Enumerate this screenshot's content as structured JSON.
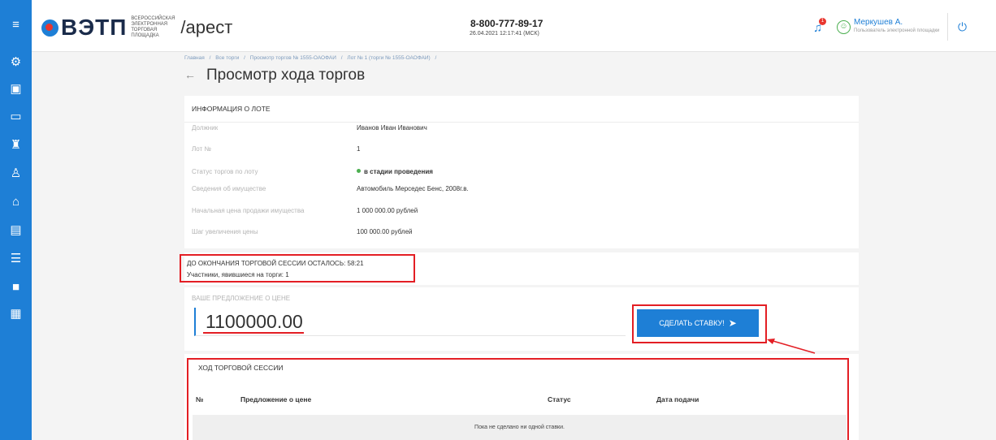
{
  "app": {
    "logo_text": "ВЭТП",
    "logo_subtitle": "ВСЕРОССИЙСКАЯ ЭЛЕКТРОННАЯ ТОРГОВАЯ ПЛОЩАДКА",
    "section": "/арест",
    "phone": "8-800-777-89-17",
    "datetime": "26.04.2021 12:17:41 (МСК)",
    "notification_count": "1"
  },
  "user": {
    "name": "Меркушев А.",
    "role": "Пользователь электронной площадки"
  },
  "sidebar": {
    "icons": [
      "menu-icon",
      "settings-icon",
      "document-icon",
      "card-icon",
      "gavel-icon",
      "bid-icon",
      "lot-icon",
      "report-icon",
      "list-icon",
      "lock-icon",
      "calendar-icon"
    ]
  },
  "breadcrumb": [
    "Главная",
    "/",
    "Все торги",
    "/",
    "Просмотр торгов № 1555-ОАОФАИ",
    "/",
    "Лот № 1 (торги № 1555-ОАОФАИ)",
    "/"
  ],
  "page": {
    "title": "Просмотр хода торгов"
  },
  "lot_info": {
    "header": "ИНФОРМАЦИЯ О ЛОТЕ",
    "rows": [
      {
        "label": "Должник",
        "value": "Иванов Иван Иванович"
      },
      {
        "label": "Лот №",
        "value": "1"
      },
      {
        "label": "Статус торгов по лоту",
        "value": "в стадии проведения"
      },
      {
        "label": "Сведения об имуществе",
        "value": "Автомобиль Мерседес Бенс, 2008г.в."
      },
      {
        "label": "Начальная цена продажи имущества",
        "value": "1 000 000.00 рублей"
      },
      {
        "label": "Шаг увеличения цены",
        "value": "100 000.00 рублей"
      }
    ]
  },
  "session_timer": {
    "remaining": "ДО ОКОНЧАНИЯ ТОРГОВОЙ СЕССИИ ОСТАЛОСЬ: 58:21",
    "participants": "Участники, явившиеся на торги: 1"
  },
  "offer": {
    "label": "ВАШЕ ПРЕДЛОЖЕНИЕ О ЦЕНЕ",
    "value": "1100000.00",
    "button": "СДЕЛАТЬ СТАВКУ!"
  },
  "session_log": {
    "header": "ХОД ТОРГОВОЙ СЕССИИ",
    "columns": [
      "№",
      "Предложение о цене",
      "Статус",
      "Дата подачи"
    ],
    "empty_text": "Пока не сделано ни одной ставки."
  },
  "colors": {
    "primary": "#1e7fd6",
    "annotation_red": "#e31e24",
    "status_green": "#4caf50"
  }
}
